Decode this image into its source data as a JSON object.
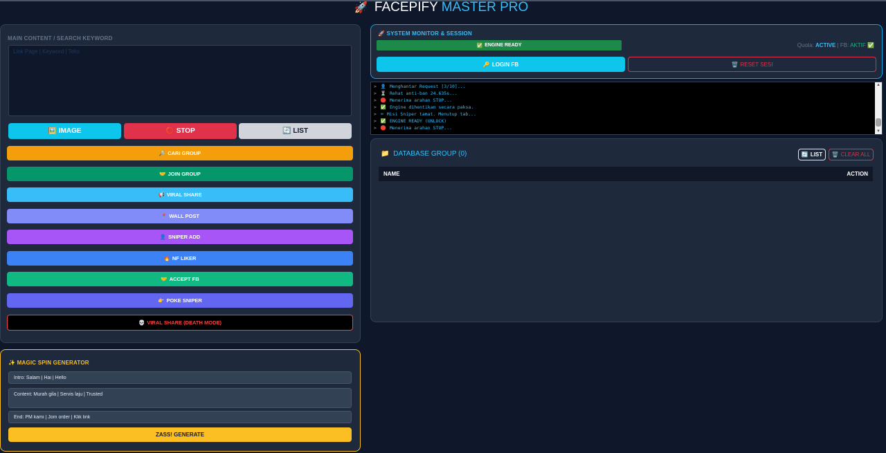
{
  "app": {
    "title_main": "FACEPIFY",
    "title_accent": "MASTER PRO"
  },
  "main": {
    "keyword_label": "MAIN CONTENT / SEARCH KEYWORD",
    "keyword_placeholder": "Link Page | Keyword | Teks",
    "buttons": {
      "image": "IMAGE",
      "stop": "STOP",
      "list": "LIST",
      "cari_group": "CARI GROUP",
      "join_group": "JOIN GROUP",
      "viral_share": "VIRAL SHARE",
      "wall_post": "WALL POST",
      "sniper_add": "SNIPER ADD",
      "nf_liker": "NF LIKER",
      "accept_fb": "ACCEPT FB",
      "poke_sniper": "POKE SNIPER",
      "viral_death": "VIRAL SHARE (DEATH MODE)"
    }
  },
  "spin": {
    "title": "MAGIC SPIN GENERATOR",
    "intro_value": "Intro: Salam | Hai | Hello",
    "content_value": "Content: Murah gila | Servis laju | Trusted",
    "end_value": "End: PM kami | Jom order | Klik link",
    "generate_label": "ZASS! GENERATE"
  },
  "monitor": {
    "title": "SYSTEM MONITOR & SESSION",
    "engine_status": "ENGINE READY",
    "quota_label": "Quota:",
    "quota_value": "ACTIVE",
    "fb_label": "| FB:",
    "fb_value": "AKTIF",
    "login_label": "LOGIN FB",
    "reset_label": "RESET SESI"
  },
  "console": {
    "lines": [
      {
        "icon": "👤",
        "text": "Menghantar Request [3/10]..."
      },
      {
        "icon": "⏳",
        "text": "Rehat anti-ban 24.635s..."
      },
      {
        "icon": "🛑",
        "text": "Menerima arahan STOP..."
      },
      {
        "icon": "✅",
        "text": "Engine dihentikan secara paksa."
      },
      {
        "icon": "⌨",
        "text": "Misi Sniper tamat. Menutup tab..."
      },
      {
        "icon": "✅",
        "text": "ENGINE READY (UNLOCK)"
      },
      {
        "icon": "🛑",
        "text": "Menerima arahan STOP..."
      }
    ]
  },
  "database": {
    "title": "DATABASE GROUP (0)",
    "list_label": "LIST",
    "clear_label": "CLEAR ALL",
    "columns": [
      "NAME",
      "ACTION"
    ]
  },
  "colors": {
    "background": "#0f172a",
    "panel": "#1e293b",
    "accent": "#38bdf8",
    "danger": "#e0324a",
    "warning": "#fbbf24"
  }
}
